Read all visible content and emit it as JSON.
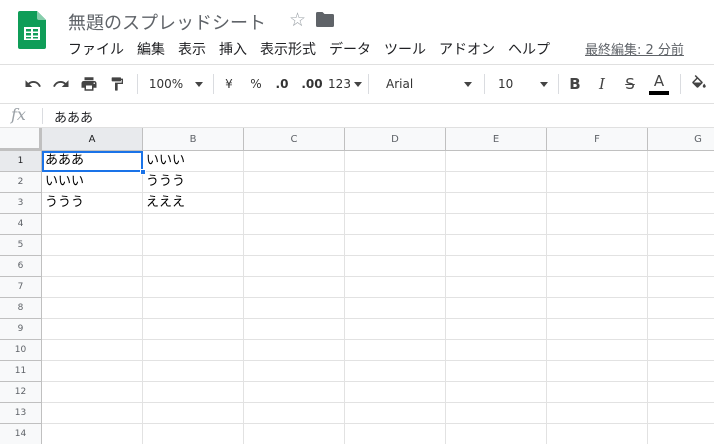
{
  "app": {
    "doc_title": "無題のスプレッドシート",
    "last_edit": "最終編集: 2 分前",
    "brand_color": "#0f9d58",
    "selection_color": "#1a73e8"
  },
  "menu": [
    "ファイル",
    "編集",
    "表示",
    "挿入",
    "表示形式",
    "データ",
    "ツール",
    "アドオン",
    "ヘルプ"
  ],
  "toolbar": {
    "zoom": "100%",
    "currency": "¥",
    "percent": "%",
    "decrease_decimal": ".0",
    "increase_decimal": ".00",
    "more_formats": "123",
    "font": "Arial",
    "font_size": "10",
    "bold": "B",
    "italic": "I",
    "strike": "S",
    "text_color": "A",
    "icons": [
      "undo-icon",
      "redo-icon",
      "print-icon",
      "paint-format-icon",
      "fill-color-icon"
    ]
  },
  "formula_bar": {
    "fx": "fx",
    "value": "あああ"
  },
  "grid": {
    "columns": [
      "A",
      "B",
      "C",
      "D",
      "E",
      "F",
      "G"
    ],
    "rows": [
      "1",
      "2",
      "3",
      "4",
      "5",
      "6",
      "7",
      "8",
      "9",
      "10",
      "11",
      "12",
      "13",
      "14"
    ],
    "cells": [
      [
        "あああ",
        "いいい",
        "",
        "",
        "",
        "",
        ""
      ],
      [
        "いいい",
        "ううう",
        "",
        "",
        "",
        "",
        ""
      ],
      [
        "ううう",
        "えええ",
        "",
        "",
        "",
        "",
        ""
      ]
    ],
    "active_cell": "A1"
  }
}
